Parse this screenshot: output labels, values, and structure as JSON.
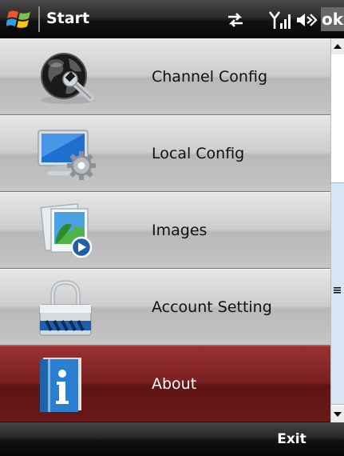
{
  "topbar": {
    "start_label": "Start",
    "ok_label": "ok",
    "icons": [
      "windows-flag-icon",
      "connectivity-icon",
      "signal-icon",
      "speaker-icon"
    ]
  },
  "menu": {
    "items": [
      {
        "label": "Channel Config",
        "icon": "globe-wrench-icon",
        "selected": false
      },
      {
        "label": "Local Config",
        "icon": "monitor-gear-icon",
        "selected": false
      },
      {
        "label": "Images",
        "icon": "image-play-icon",
        "selected": false
      },
      {
        "label": "Account Setting",
        "icon": "padlock-icon",
        "selected": false
      },
      {
        "label": "About",
        "icon": "info-book-icon",
        "selected": true
      }
    ]
  },
  "bottombar": {
    "exit_label": "Exit"
  },
  "colors": {
    "selected_row": "#7a1f1f",
    "menu_row": "#cdcdcd",
    "scroll_thumb": "#d6e6f4"
  }
}
